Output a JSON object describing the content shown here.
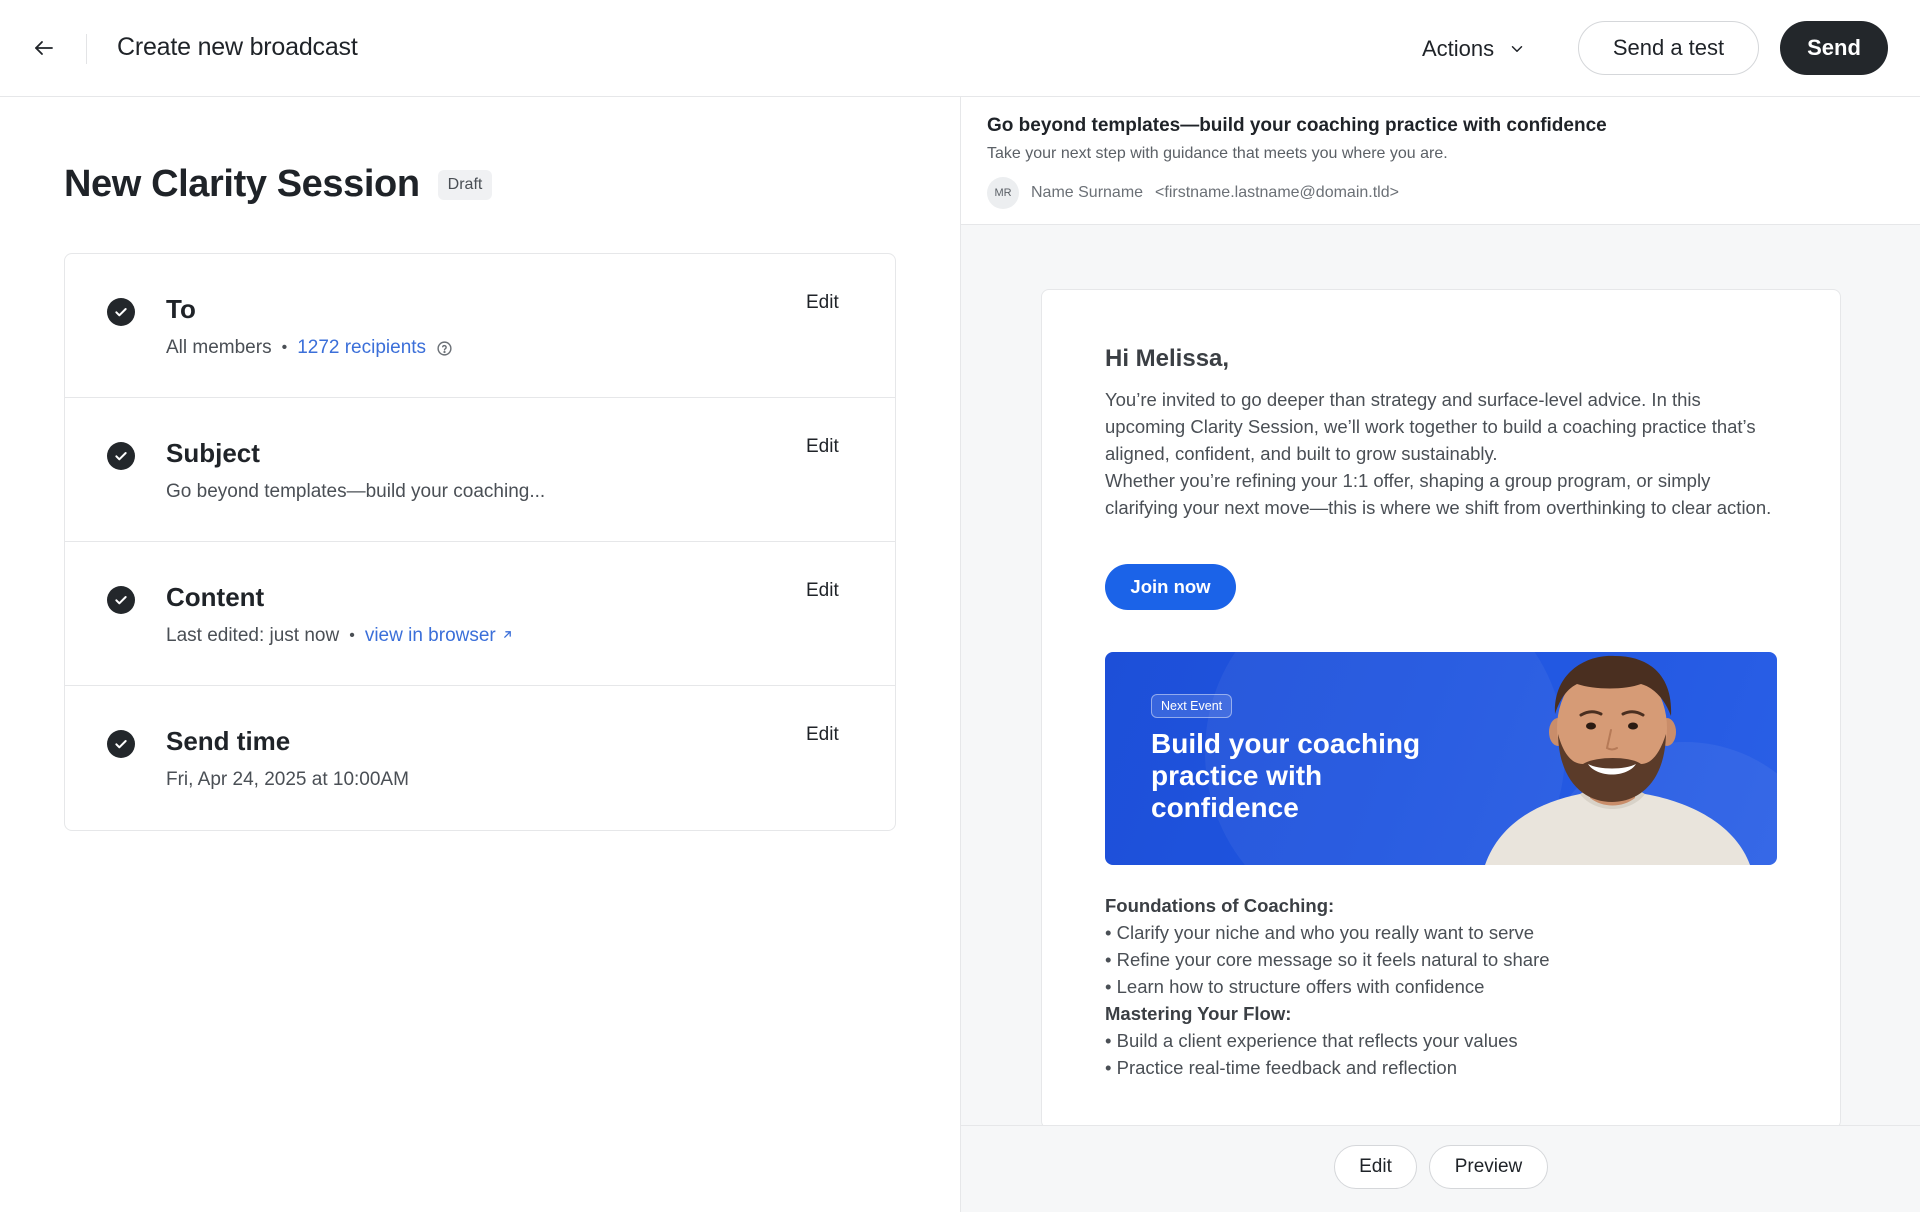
{
  "header": {
    "title": "Create new broadcast",
    "actions_label": "Actions",
    "send_test_label": "Send a test",
    "send_label": "Send"
  },
  "broadcast": {
    "name": "New Clarity Session",
    "status": "Draft"
  },
  "steps": {
    "to": {
      "title": "To",
      "audience": "All members",
      "recipients": "1272 recipients",
      "edit": "Edit"
    },
    "subject": {
      "title": "Subject",
      "value": "Go beyond templates—build your coaching...",
      "edit": "Edit"
    },
    "content": {
      "title": "Content",
      "last_edited": "Last edited: just now",
      "view_link": "view in browser",
      "edit": "Edit"
    },
    "send_time": {
      "title": "Send time",
      "value": "Fri, Apr 24, 2025 at 10:00AM",
      "edit": "Edit"
    }
  },
  "email": {
    "subject": "Go beyond templates—build your coaching practice with confidence",
    "preheader": "Take your next step with guidance that meets you where you are.",
    "sender_initials": "MR",
    "sender_name": "Name Surname",
    "sender_email": "<firstname.lastname@domain.tld>",
    "greeting": "Hi Melissa,",
    "paragraph_1": "You’re invited to go deeper than strategy and surface-level advice. In this upcoming Clarity Session, we’ll work together to build a coaching practice that’s aligned, confident, and built to grow sustainably.",
    "paragraph_2": "Whether you’re refining your 1:1 offer, shaping a group program, or simply clarifying your next move—this is where we shift from overthinking to clear action.",
    "cta_label": "Join now",
    "banner": {
      "chip": "Next Event",
      "title": "Build your coaching practice with confidence"
    },
    "section_1": {
      "heading": "Foundations of Coaching:",
      "items": [
        "• Clarify your niche and who you really want to serve",
        "• Refine your core message so it feels natural to share",
        "• Learn how to structure offers with confidence"
      ]
    },
    "section_2": {
      "heading": "Mastering Your Flow:",
      "items": [
        "• Build a client experience that reflects your values",
        "• Practice real-time feedback and reflection"
      ]
    }
  },
  "preview_footer": {
    "edit_label": "Edit",
    "preview_label": "Preview"
  },
  "colors": {
    "accent_blue": "#1b63e8",
    "link_blue": "#3b6fd9",
    "dark_button": "#23272b",
    "banner_blue": "#1f55e0"
  }
}
